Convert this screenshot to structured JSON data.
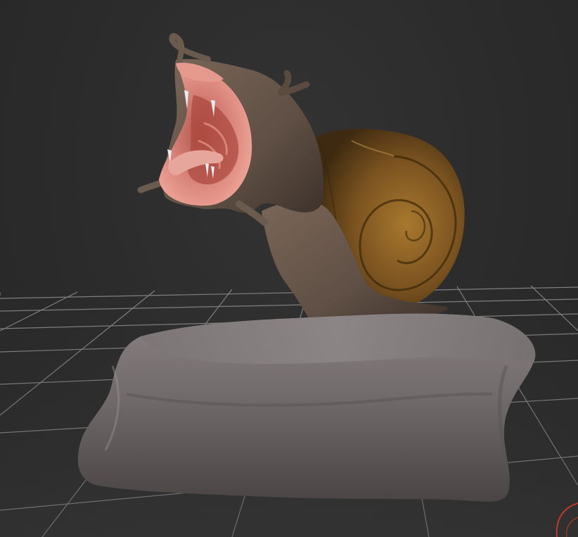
{
  "viewport": {
    "background_color": "#2c2c2c",
    "grid_color": "#8a8a8a",
    "view_gizmo_color": "#c0392b"
  },
  "model": {
    "rock_color": "#6f6868",
    "shell_color": "#7a5420",
    "skin_color": "#6b5a4e",
    "mouth_color": "#d9857a",
    "tooth_color": "#e6ecf0"
  }
}
